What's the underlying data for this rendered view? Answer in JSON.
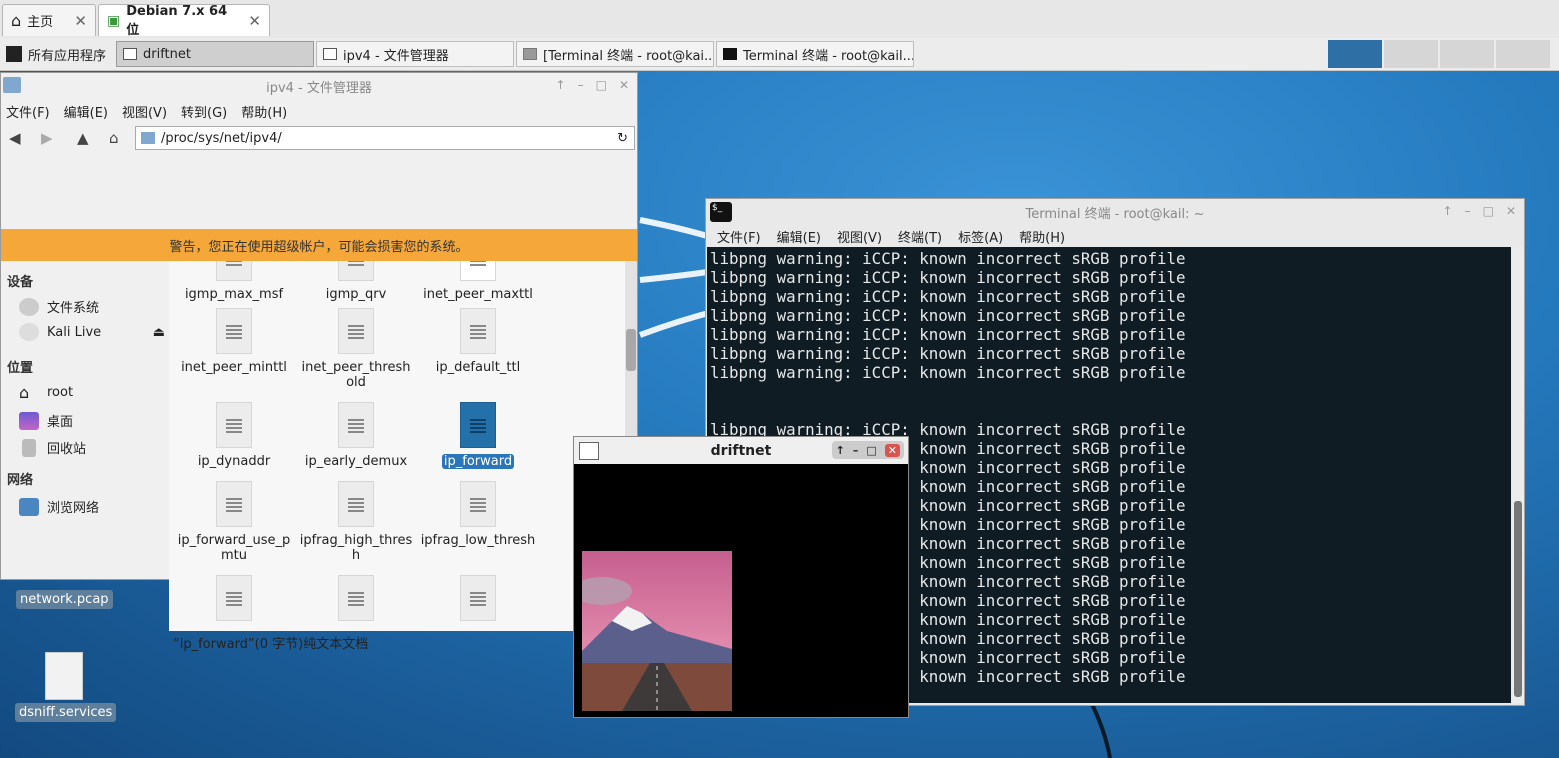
{
  "vm_tabs": [
    {
      "label": "主页",
      "icon": "home-icon"
    },
    {
      "label": "Debian 7.x 64 位",
      "icon": "vm-play-icon"
    }
  ],
  "taskbar": {
    "apps_menu": "所有应用程序",
    "tasks": [
      "driftnet",
      "ipv4 - 文件管理器",
      "[Terminal 终端 - root@kai...",
      "Terminal 终端 - root@kail..."
    ]
  },
  "file_manager": {
    "title": "ipv4 - 文件管理器",
    "menu": [
      "文件(F)",
      "编辑(E)",
      "视图(V)",
      "转到(G)",
      "帮助(H)"
    ],
    "path": "/proc/sys/net/ipv4/",
    "warning": "警告，您正在使用超级帐户，可能会损害您的系统。",
    "sidebar": {
      "devices_header": "设备",
      "devices": [
        "文件系统",
        "Kali Live"
      ],
      "places_header": "位置",
      "places": [
        "root",
        "桌面",
        "回收站"
      ],
      "network_header": "网络",
      "network": [
        "浏览网络"
      ]
    },
    "files": [
      "igmp_max_msf",
      "igmp_qrv",
      "inet_peer_maxttl",
      "inet_peer_minttl",
      "inet_peer_thresh\nold",
      "ip_default_ttl",
      "ip_dynaddr",
      "ip_early_demux",
      "ip_forward",
      "ip_forward_use_p\nmtu",
      "ipfrag_high_thres\nh",
      "ipfrag_low_thresh"
    ],
    "selected_file": "ip_forward",
    "status": "“ip_forward”(0 字节)纯文本文档"
  },
  "desktop_icons": [
    "network.pcap",
    "dsniff.services"
  ],
  "terminal": {
    "title": "Terminal 终端 - root@kail: ~",
    "menu": [
      "文件(F)",
      "编辑(E)",
      "视图(V)",
      "终端(T)",
      "标签(A)",
      "帮助(H)"
    ],
    "lines": [
      "libpng warning: iCCP: known incorrect sRGB profile",
      "libpng warning: iCCP: known incorrect sRGB profile",
      "libpng warning: iCCP: known incorrect sRGB profile",
      "libpng warning: iCCP: known incorrect sRGB profile",
      "libpng warning: iCCP: known incorrect sRGB profile",
      "libpng warning: iCCP: known incorrect sRGB profile",
      "libpng warning: iCCP: known incorrect sRGB profile",
      "",
      "",
      "libpng warning: iCCP: known incorrect sRGB profile",
      "libpng warning: iCCP: known incorrect sRGB profile",
      "libpng warning: iCCP: known incorrect sRGB profile",
      "libpng warning: iCCP: known incorrect sRGB profile",
      "libpng warning: iCCP: known incorrect sRGB profile",
      "libpng warning: iCCP: known incorrect sRGB profile",
      "libpng warning: iCCP: known incorrect sRGB profile",
      "libpng warning: iCCP: known incorrect sRGB profile",
      "libpng warning: iCCP: known incorrect sRGB profile",
      "libpng warning: iCCP: known incorrect sRGB profile",
      "libpng warning: iCCP: known incorrect sRGB profile",
      "libpng warning: iCCP: known incorrect sRGB profile",
      "libpng warning: iCCP: known incorrect sRGB profile",
      "libpng warning: iCCP: known incorrect sRGB profile"
    ]
  },
  "driftnet": {
    "title": "driftnet"
  },
  "colors": {
    "accent": "#2a76b8",
    "warning": "#f5a73a",
    "terminal_bg": "#0f1c24",
    "close_red": "#d9534f"
  }
}
